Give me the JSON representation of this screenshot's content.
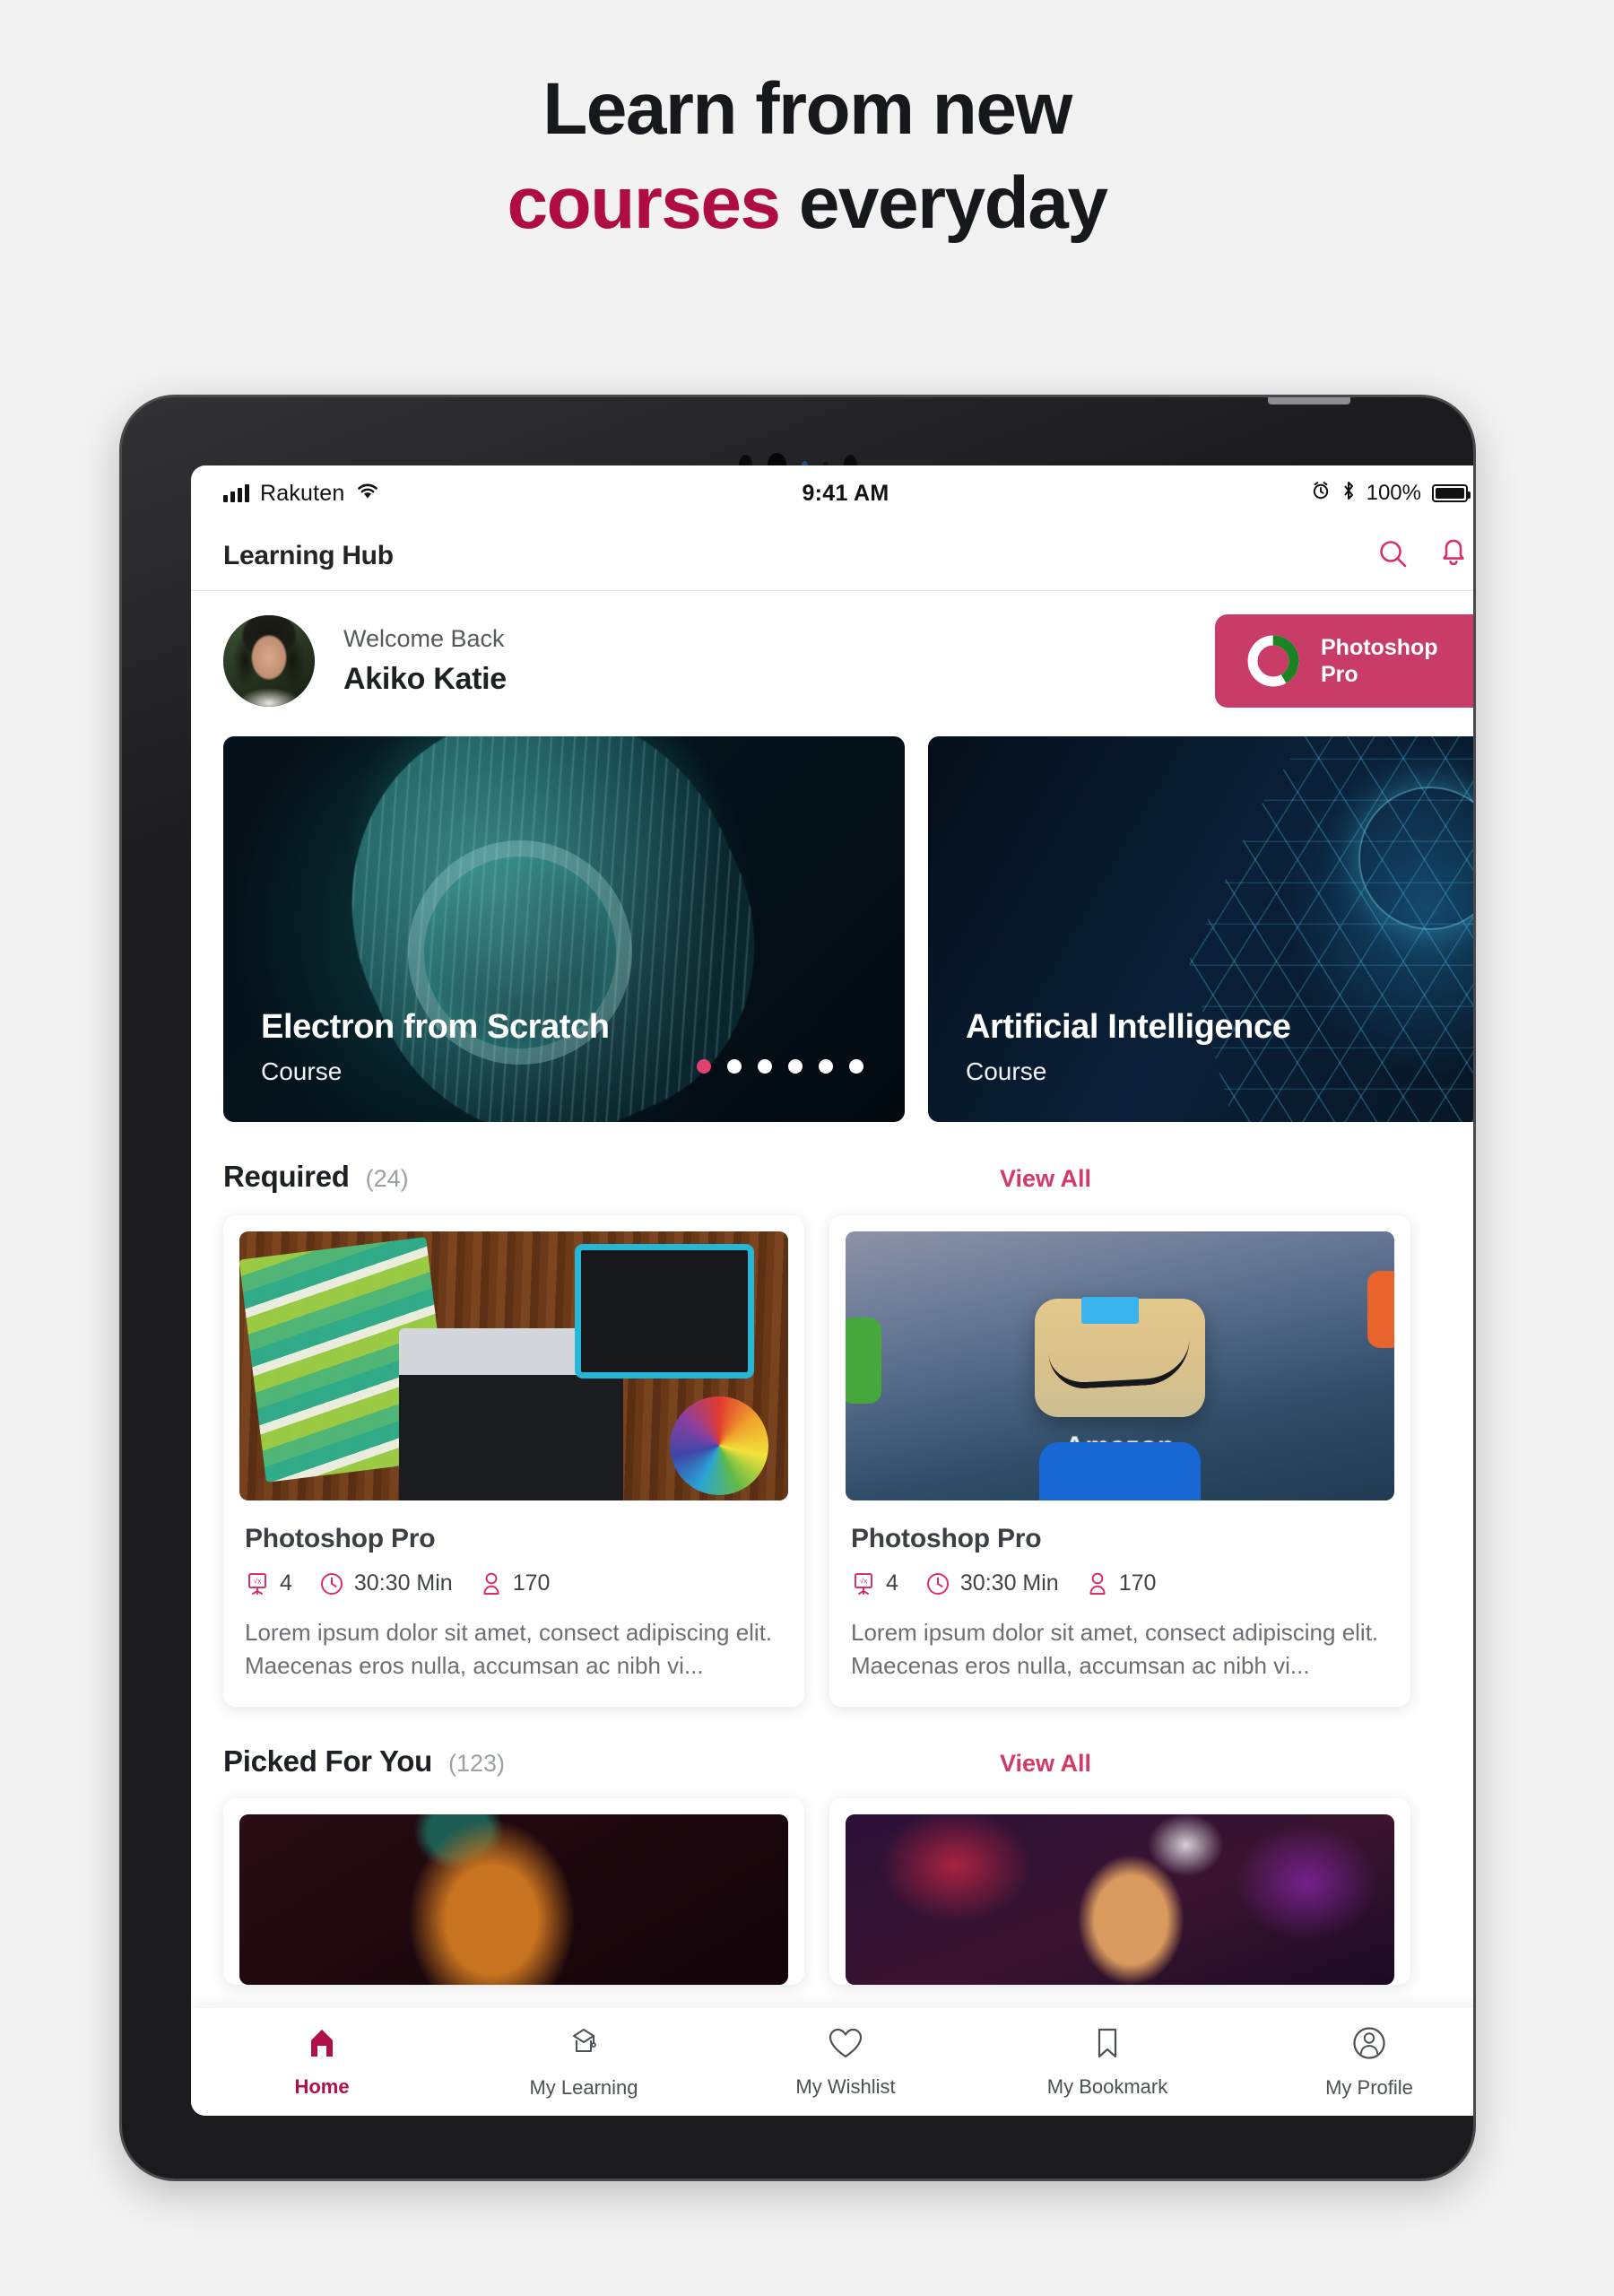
{
  "promo": {
    "line1": "Learn from new",
    "accent_word": "courses",
    "line2_rest": " everyday",
    "accent_color": "#af0c44"
  },
  "status_bar": {
    "carrier": "Rakuten",
    "time": "9:41 AM",
    "battery_percent": "100%",
    "icons": [
      "signal-icon",
      "wifi-icon",
      "alarm-icon",
      "bluetooth-icon",
      "battery-icon"
    ]
  },
  "app_bar": {
    "title": "Learning Hub",
    "actions": [
      {
        "name": "search-icon"
      },
      {
        "name": "notification-bell-icon"
      }
    ]
  },
  "welcome": {
    "greeting": "Welcome Back",
    "user_name": "Akiko Katie",
    "avatar_alt": "user-avatar"
  },
  "progress_badge": {
    "title_line1": "Photoshop",
    "title_line2": "Pro",
    "background_color": "#c93c68",
    "ring_color": "#1a8423",
    "ring_track_color": "#ffffff",
    "progress_percent": 42
  },
  "carousel": {
    "slides": [
      {
        "title": "Electron from Scratch",
        "subtitle": "Course"
      },
      {
        "title": "Artificial Intelligence",
        "subtitle": "Course"
      }
    ],
    "dot_count": 6,
    "active_dot_index": 0,
    "active_dot_color": "#e1416f"
  },
  "sections": [
    {
      "title": "Required",
      "count": "(24)",
      "view_all": "View All",
      "courses": [
        {
          "thumb": "design-desk-photo",
          "name": "Photoshop Pro",
          "lessons": "4",
          "duration": "30:30 Min",
          "students": "170",
          "description": "Lorem ipsum dolor sit amet, consect adipiscing elit. Maecenas eros nulla, accumsan ac nibh vi..."
        },
        {
          "thumb": "amazon-app-icon-photo",
          "name": "Photoshop Pro",
          "lessons": "4",
          "duration": "30:30 Min",
          "students": "170",
          "description": "Lorem ipsum dolor sit amet, consect adipiscing elit. Maecenas eros nulla, accumsan ac nibh vi..."
        }
      ]
    },
    {
      "title": "Picked For You",
      "count": "(123)",
      "view_all": "View All",
      "courses": [
        {
          "thumb": "dark-portrait-photo"
        },
        {
          "thumb": "concert-crowd-photo"
        }
      ]
    }
  ],
  "tab_bar": {
    "active_color": "#b01048",
    "inactive_color": "#4c5057",
    "items": [
      {
        "label": "Home",
        "icon": "home-icon",
        "active": true
      },
      {
        "label": "My Learning",
        "icon": "graduation-cap-icon",
        "active": false
      },
      {
        "label": "My Wishlist",
        "icon": "heart-icon",
        "active": false
      },
      {
        "label": "My Bookmark",
        "icon": "bookmark-icon",
        "active": false
      },
      {
        "label": "My Profile",
        "icon": "user-circle-icon",
        "active": false
      }
    ]
  }
}
